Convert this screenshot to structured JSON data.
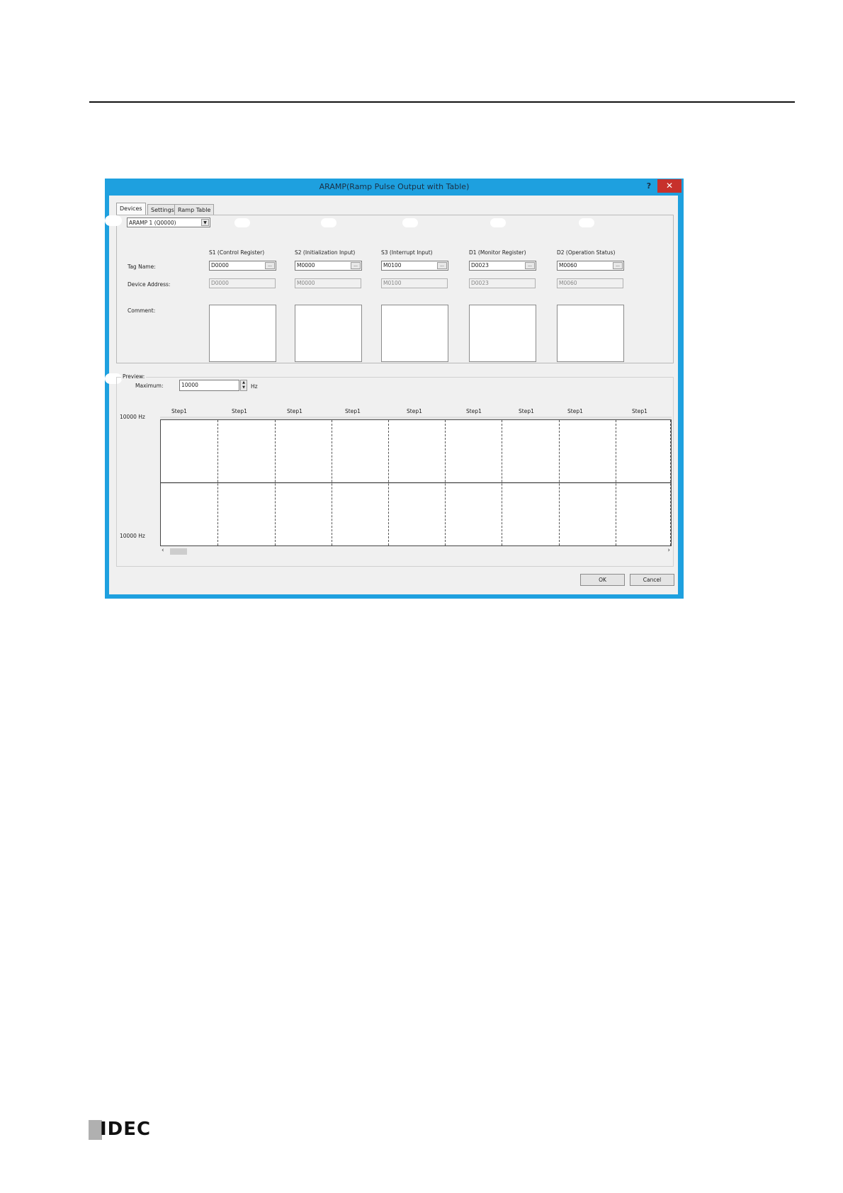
{
  "dialog": {
    "title": "ARAMP(Ramp Pulse Output with Table)",
    "help": "?",
    "close": "✕"
  },
  "tabs": [
    {
      "label": "Devices"
    },
    {
      "label": "Settings"
    },
    {
      "label": "Ramp Table"
    }
  ],
  "devices": {
    "instruction_select": "ARAMP 1 (Q0000)",
    "row_labels": {
      "tag_name": "Tag Name:",
      "device_address": "Device Address:",
      "comment": "Comment:"
    },
    "columns": [
      {
        "header": "S1 (Control Register)",
        "tag": "D0000",
        "address": "D0000"
      },
      {
        "header": "S2 (Initialization Input)",
        "tag": "M0000",
        "address": "M0000"
      },
      {
        "header": "S3 (Interrupt Input)",
        "tag": "M0100",
        "address": "M0100"
      },
      {
        "header": "D1 (Monitor Register)",
        "tag": "D0023",
        "address": "D0023"
      },
      {
        "header": "D2 (Operation Status)",
        "tag": "M0060",
        "address": "M0060"
      }
    ],
    "browse": "..."
  },
  "preview": {
    "label": "Preview:",
    "maximum_label": "Maximum:",
    "maximum_value": "10000",
    "unit": "Hz",
    "steps": [
      "Step1",
      "Step1",
      "Step1",
      "Step1",
      "Step1",
      "Step1",
      "Step1",
      "Step1",
      "Step1"
    ],
    "y_top": "10000 Hz",
    "y_bottom": "10000 Hz",
    "scroll_left": "‹",
    "scroll_right": "›"
  },
  "buttons": {
    "ok": "OK",
    "cancel": "Cancel"
  },
  "footer": {
    "logo": "IDEC"
  }
}
